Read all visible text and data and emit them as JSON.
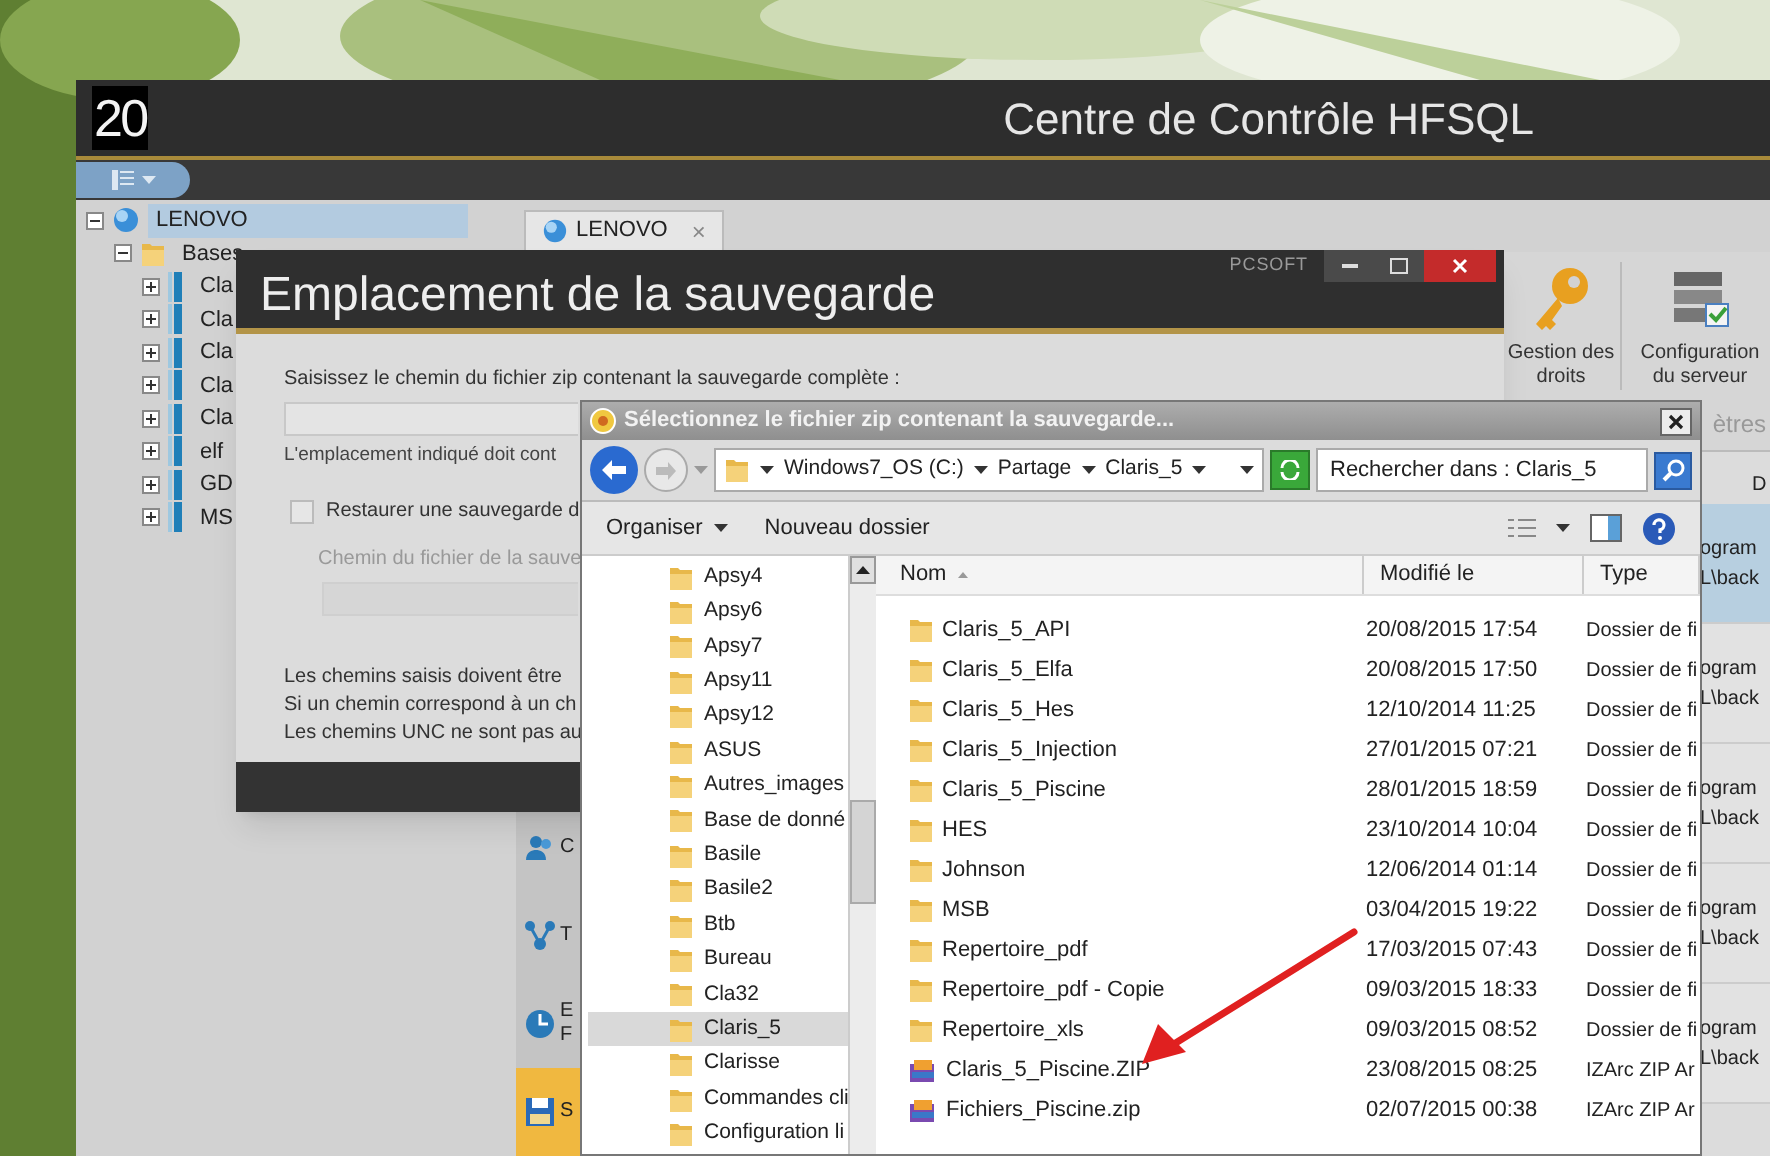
{
  "app": {
    "logo": "20",
    "title": "Centre de Contrôle HFSQL",
    "tree": [
      {
        "label": "LENOVO",
        "selected": true,
        "expanded": true,
        "children": [
          {
            "label": "Bases",
            "selected": false,
            "expanded": true,
            "children": [
              {
                "label": "Cla",
                "selected": false,
                "expanded": false
              },
              {
                "label": "Cla",
                "selected": false,
                "expanded": false
              },
              {
                "label": "Cla",
                "selected": false,
                "expanded": false
              },
              {
                "label": "Cla",
                "selected": false,
                "expanded": false
              },
              {
                "label": "Cla",
                "selected": false,
                "expanded": false
              },
              {
                "label": "elf",
                "selected": false,
                "expanded": false
              },
              {
                "label": "GD",
                "selected": false,
                "expanded": false
              },
              {
                "label": "MS",
                "selected": false,
                "expanded": false
              }
            ]
          }
        ]
      }
    ],
    "tab": {
      "label": "LENOVO",
      "close": "×"
    },
    "ribbon": [
      {
        "kind": "key",
        "label": "Gestion des droits"
      },
      {
        "kind": "server",
        "label": "Configuration du serveur"
      }
    ],
    "ribbon_group": "ètres",
    "side_items": [
      {
        "kind": "users",
        "lines": [
          "C"
        ],
        "selected": false
      },
      {
        "kind": "network",
        "lines": [
          "T"
        ],
        "selected": false
      },
      {
        "kind": "clock",
        "lines": [
          "E",
          "F"
        ],
        "selected": false
      },
      {
        "kind": "save",
        "lines": [
          "S"
        ],
        "selected": true
      }
    ],
    "list_header": "D",
    "list_rows": [
      {
        "lines": [
          "ogram",
          "L\\back"
        ],
        "selected": true
      },
      {
        "lines": [
          "ogram",
          "L\\back"
        ],
        "selected": false
      },
      {
        "lines": [
          "ogram",
          "L\\back"
        ],
        "selected": false
      },
      {
        "lines": [
          "ogram",
          "L\\back"
        ],
        "selected": false
      },
      {
        "lines": [
          "ogram",
          "L\\back"
        ],
        "selected": false
      }
    ]
  },
  "backup_dialog": {
    "title": "Emplacement de la sauvegarde",
    "brand": "PCSOFT",
    "prompt": "Saisissez le chemin du fichier zip contenant la sauvegarde complète :",
    "note": "L'emplacement indiqué doit cont",
    "restore": {
      "label": "Restaurer une sauvegarde d",
      "checked": false
    },
    "restore_path": {
      "label": "Chemin du fichier de la sauve",
      "disabled": true
    },
    "lines": [
      "Les chemins saisis doivent être",
      "Si un chemin correspond à un ch",
      "Les chemins UNC ne sont pas au"
    ]
  },
  "file_dialog": {
    "title": "Sélectionnez le fichier zip contenant la sauvegarde...",
    "breadcrumb": [
      "Windows7_OS (C:)",
      "Partage",
      "Claris_5"
    ],
    "search": {
      "placeholder": "Rechercher dans : Claris_5"
    },
    "toolbar": [
      {
        "label": "Organiser",
        "dropdown": true
      },
      {
        "label": "Nouveau dossier",
        "dropdown": false
      }
    ],
    "nav": [
      {
        "label": "Apsy4",
        "selected": false
      },
      {
        "label": "Apsy6",
        "selected": false
      },
      {
        "label": "Apsy7",
        "selected": false
      },
      {
        "label": "Apsy11",
        "selected": false
      },
      {
        "label": "Apsy12",
        "selected": false
      },
      {
        "label": "ASUS",
        "selected": false
      },
      {
        "label": "Autres_images",
        "selected": false
      },
      {
        "label": "Base de donné",
        "selected": false
      },
      {
        "label": "Basile",
        "selected": false
      },
      {
        "label": "Basile2",
        "selected": false
      },
      {
        "label": "Btb",
        "selected": false
      },
      {
        "label": "Bureau",
        "selected": false
      },
      {
        "label": "Cla32",
        "selected": false
      },
      {
        "label": "Claris_5",
        "selected": true
      },
      {
        "label": "Clarisse",
        "selected": false
      },
      {
        "label": "Commandes cli",
        "selected": false
      },
      {
        "label": "Configuration li",
        "selected": false
      }
    ],
    "columns": [
      {
        "label": "Nom",
        "sorted": true
      },
      {
        "label": "Modifié le",
        "sorted": false
      },
      {
        "label": "Type",
        "sorted": false
      }
    ],
    "files": [
      {
        "kind": "folder",
        "name": "Claris_5_API",
        "modified": "20/08/2015 17:54",
        "type": "Dossier de fi"
      },
      {
        "kind": "folder",
        "name": "Claris_5_Elfa",
        "modified": "20/08/2015 17:50",
        "type": "Dossier de fi"
      },
      {
        "kind": "folder",
        "name": "Claris_5_Hes",
        "modified": "12/10/2014 11:25",
        "type": "Dossier de fi"
      },
      {
        "kind": "folder",
        "name": "Claris_5_Injection",
        "modified": "27/01/2015 07:21",
        "type": "Dossier de fi"
      },
      {
        "kind": "folder",
        "name": "Claris_5_Piscine",
        "modified": "28/01/2015 18:59",
        "type": "Dossier de fi"
      },
      {
        "kind": "folder",
        "name": "HES",
        "modified": "23/10/2014 10:04",
        "type": "Dossier de fi"
      },
      {
        "kind": "folder",
        "name": "Johnson",
        "modified": "12/06/2014 01:14",
        "type": "Dossier de fi"
      },
      {
        "kind": "folder",
        "name": "MSB",
        "modified": "03/04/2015 19:22",
        "type": "Dossier de fi"
      },
      {
        "kind": "folder",
        "name": "Repertoire_pdf",
        "modified": "17/03/2015 07:43",
        "type": "Dossier de fi"
      },
      {
        "kind": "folder",
        "name": "Repertoire_pdf - Copie",
        "modified": "09/03/2015 18:33",
        "type": "Dossier de fi"
      },
      {
        "kind": "folder",
        "name": "Repertoire_xls",
        "modified": "09/03/2015 08:52",
        "type": "Dossier de fi"
      },
      {
        "kind": "zip",
        "name": "Claris_5_Piscine.ZIP",
        "modified": "23/08/2015 08:25",
        "type": "IZArc ZIP Ar"
      },
      {
        "kind": "zip",
        "name": "Fichiers_Piscine.zip",
        "modified": "02/07/2015 00:38",
        "type": "IZArc ZIP Ar"
      }
    ]
  }
}
